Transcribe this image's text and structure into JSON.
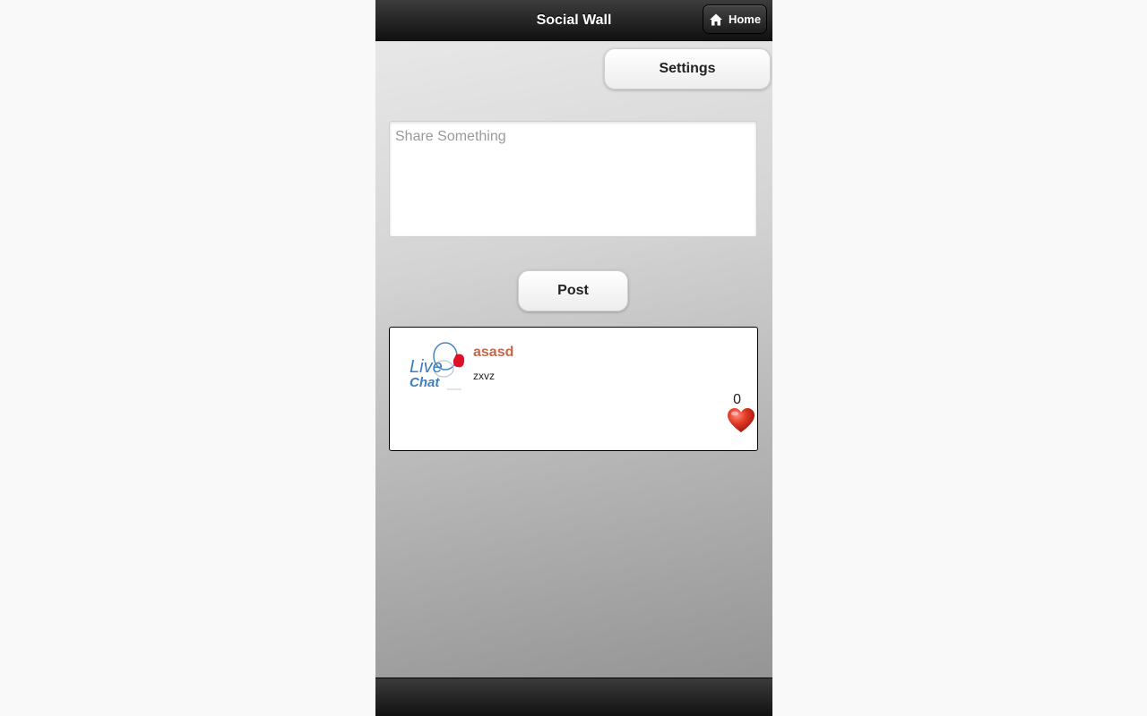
{
  "header": {
    "title": "Social Wall",
    "home_label": "Home"
  },
  "toolbar": {
    "settings_label": "Settings"
  },
  "composer": {
    "placeholder": "Share Something",
    "value": "",
    "post_label": "Post"
  },
  "posts": [
    {
      "avatar_icon": "live-chat-logo",
      "avatar_text_line1": "Live",
      "avatar_text_line2": "Chat",
      "user": "asasd",
      "text": "zxvz",
      "likes": "0",
      "like_icon": "heart-icon"
    }
  ],
  "colors": {
    "header_bg": "#1c1c1c",
    "username": "#c8664a",
    "heart": "#d42a1c"
  }
}
